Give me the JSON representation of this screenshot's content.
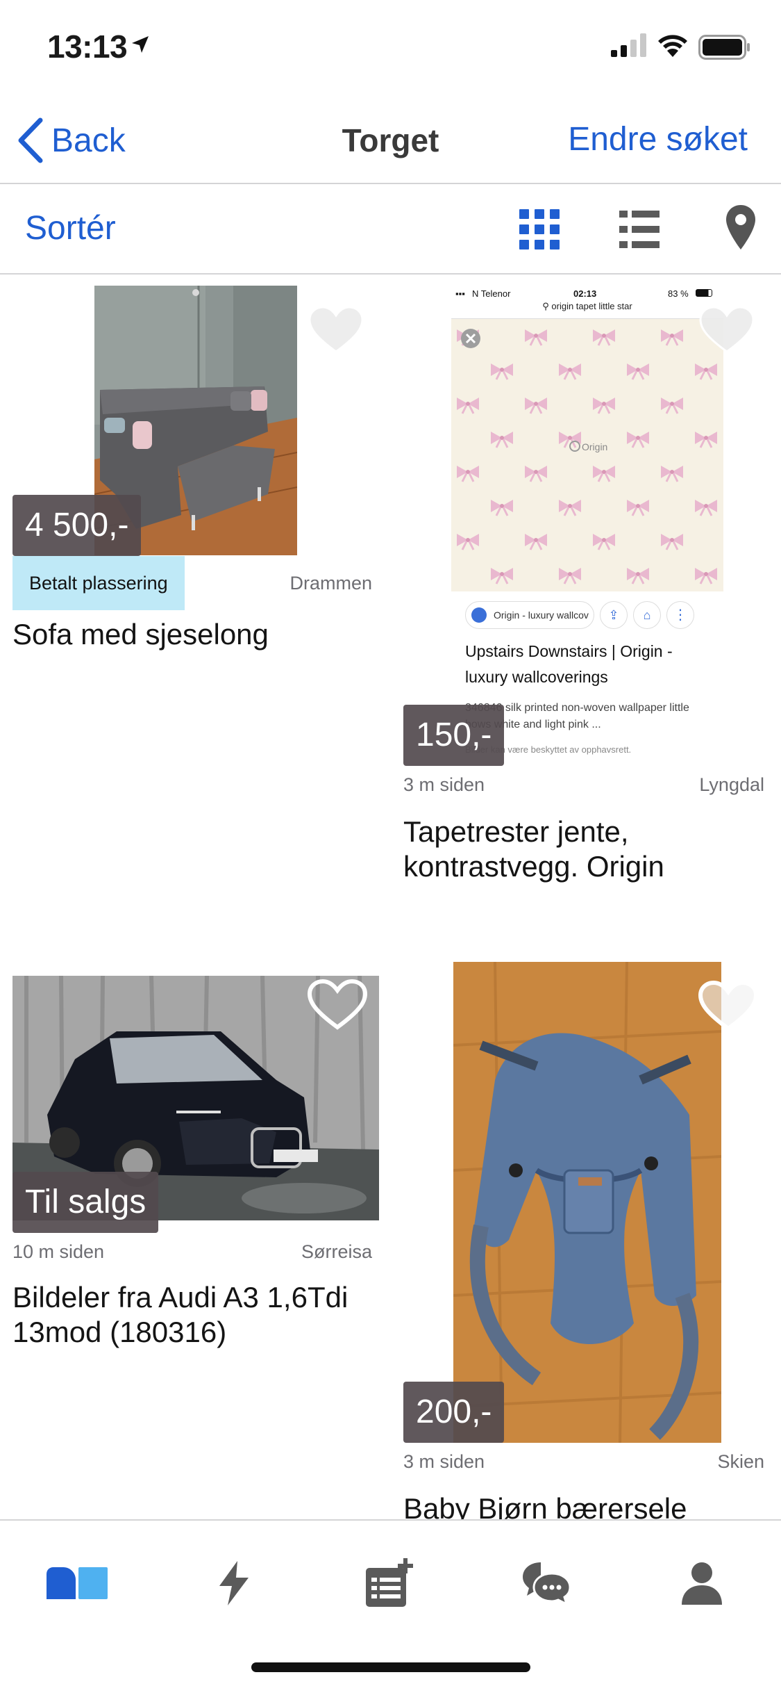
{
  "status_bar": {
    "time": "13:13",
    "icons": [
      "location-arrow-icon",
      "cellular-signal-icon",
      "wifi-icon",
      "battery-icon"
    ]
  },
  "nav": {
    "back_label": "Back",
    "title": "Torget",
    "edit_label": "Endre søket",
    "accent_color": "#1f5ed1"
  },
  "toolbar": {
    "sort_label": "Sortér",
    "views": [
      "grid-view-icon",
      "list-view-icon",
      "map-pin-icon"
    ],
    "active_view": "grid"
  },
  "listings": [
    {
      "price": "4 500,-",
      "tag": "Betalt plassering",
      "age": "",
      "location": "Drammen",
      "title": "Sofa med sjeselong",
      "favorited": false
    },
    {
      "price": "150,-",
      "tag": "",
      "age": "3 m siden",
      "location": "Lyngdal",
      "title": "Tapetrester jente, kontrastvegg. Origin",
      "favorited": false,
      "screenshot_text": {
        "carrier": "N Telenor",
        "time": "02:13",
        "battery": "83 %",
        "search_query": "origin tapet little star",
        "watermark": "Origin",
        "chip": "Origin - luxury wallcov",
        "result_title": "Upstairs Downstairs | Origin - luxury wallcoverings",
        "result_desc": "346846 silk printed non-woven wallpaper little bows white and light pink ...",
        "result_note": "Bilder kan være beskyttet av opphavsrett."
      }
    },
    {
      "price": "Til salgs",
      "tag": "",
      "age": "10 m siden",
      "location": "Sørreisa",
      "title": "Bildeler fra Audi A3 1,6Tdi 13mod (180316)",
      "favorited": false
    },
    {
      "price": "200,-",
      "tag": "",
      "age": "3 m siden",
      "location": "Skien",
      "title": "Baby Bjørn bærersele",
      "favorited": false
    }
  ],
  "tab_bar": {
    "tabs": [
      "marketplace-home-icon",
      "lightning-icon",
      "new-ad-icon",
      "messages-icon",
      "profile-icon"
    ],
    "active_tab": "marketplace-home-icon"
  },
  "colors": {
    "accent": "#1f5ed1",
    "price_badge": "#534a4e",
    "paid_tag": "#bfe9f7",
    "meta_text": "#6d6d72"
  }
}
